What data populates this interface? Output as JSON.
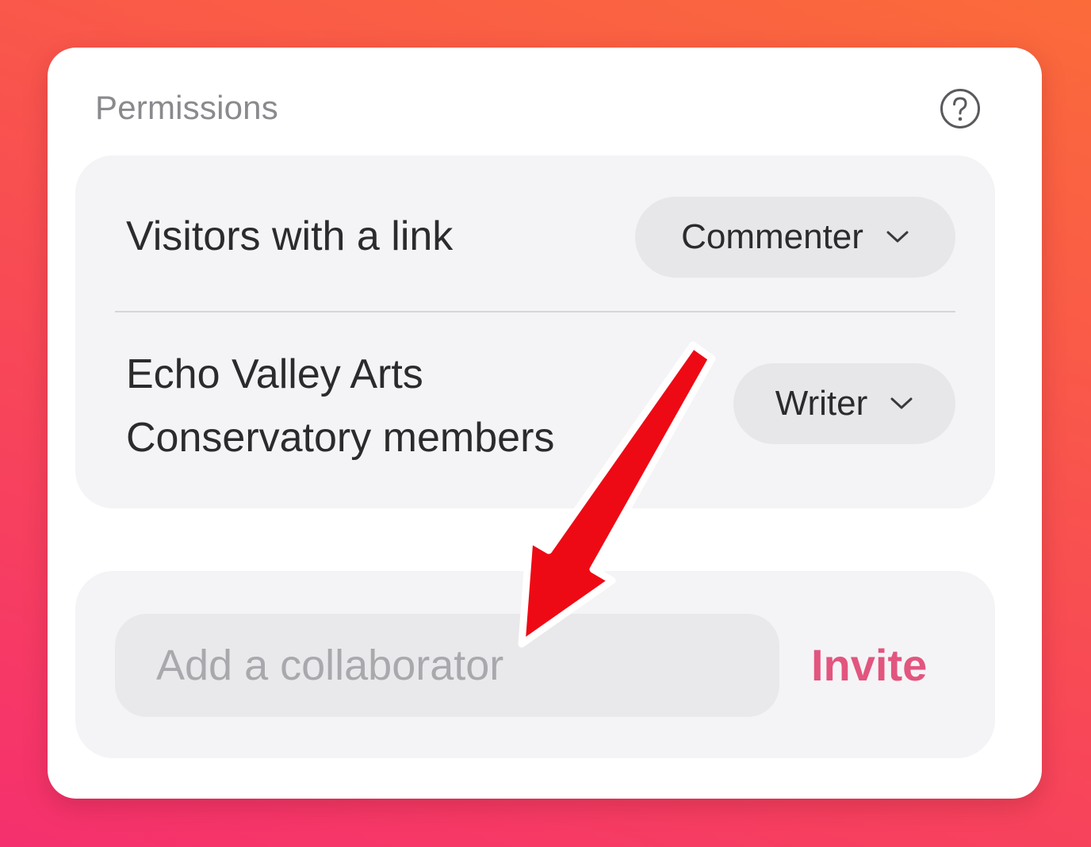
{
  "permissions": {
    "title": "Permissions",
    "help_icon": "question-circle-icon",
    "rows": [
      {
        "label": "Visitors with a link",
        "role": "Commenter"
      },
      {
        "label": "Echo Valley Arts Conservatory members",
        "role": "Writer"
      }
    ]
  },
  "invite": {
    "placeholder": "Add a collaborator",
    "value": "",
    "button_label": "Invite"
  },
  "annotation": {
    "arrow_icon": "red-arrow-icon",
    "color": "#ee0a14"
  },
  "colors": {
    "accent": "#e2557f",
    "panel": "#f4f4f6",
    "select": "#e7e7ea"
  }
}
